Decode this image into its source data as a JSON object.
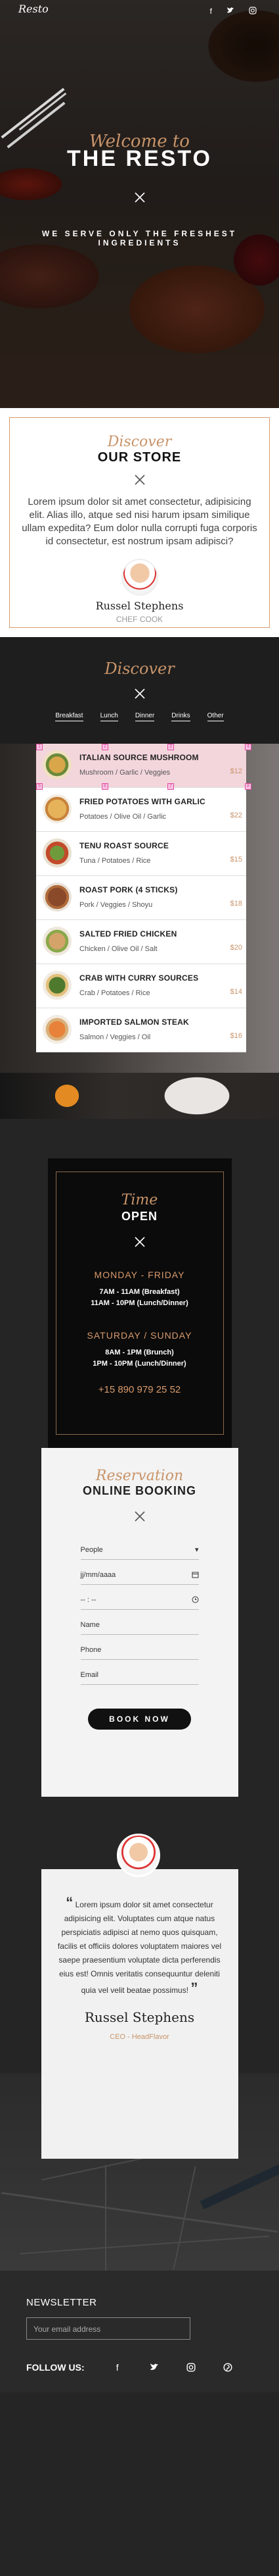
{
  "header": {
    "brand": "Resto",
    "social": [
      "f",
      "t",
      "i"
    ]
  },
  "hero": {
    "welcome": "Welcome to",
    "title": "THE RESTO",
    "subtitle": "WE SERVE ONLY THE FRESHEST INGREDIENTS"
  },
  "store": {
    "script_title": "Discover",
    "title": "OUR STORE",
    "text": "Lorem ipsum dolor sit amet consectetur, adipisicing elit. Alias illo, atque sed nisi harum ipsam similique ullam expedita? Eum dolor nulla corrupti fuga corporis id consectetur, est nostrum ipsam adipisci?",
    "chef_name": "Russel Stephens",
    "chef_role": "CHEF COOK"
  },
  "menu": {
    "script_title": "Discover",
    "tabs": [
      "Breakfast",
      "Lunch",
      "Dinner",
      "Drinks",
      "Other"
    ],
    "items": [
      {
        "name": "ITALIAN SOURCE MUSHROOM",
        "ingredients": "Mushroom / Garlic / Veggies",
        "price": "$12"
      },
      {
        "name": "FRIED POTATOES WITH GARLIC",
        "ingredients": "Potatoes / Olive Oil / Garlic",
        "price": "$22"
      },
      {
        "name": "TENU ROAST SOURCE",
        "ingredients": "Tuna / Potatoes / Rice",
        "price": "$15"
      },
      {
        "name": "ROAST PORK (4 STICKS)",
        "ingredients": "Pork / Veggies / Shoyu",
        "price": "$18"
      },
      {
        "name": "SALTED FRIED CHICKEN",
        "ingredients": "Chicken / Olive Oil / Salt",
        "price": "$20"
      },
      {
        "name": "CRAB WITH CURRY SOURCES",
        "ingredients": "Crab / Potatoes / Rice",
        "price": "$14"
      },
      {
        "name": "IMPORTED SALMON STEAK",
        "ingredients": "Salmon / Veggies / Oil",
        "price": "$16"
      }
    ]
  },
  "time": {
    "script_title": "Time",
    "title": "OPEN",
    "weekday_label": "MONDAY - FRIDAY",
    "weekday_hours_1": "7AM - 11AM (Breakfast)",
    "weekday_hours_2": "11AM - 10PM (Lunch/Dinner)",
    "weekend_label": "SATURDAY / SUNDAY",
    "weekend_hours_1": "8AM - 1PM (Brunch)",
    "weekend_hours_2": "1PM - 10PM (Lunch/Dinner)",
    "phone": "+15 890 979 25 52"
  },
  "reservation": {
    "script_title": "Reservation",
    "title": "ONLINE BOOKING",
    "people_value": "People",
    "date_placeholder": "jj/mm/aaaa",
    "time_placeholder": "-- : --",
    "name_placeholder": "Name",
    "phone_placeholder": "Phone",
    "email_placeholder": "Email",
    "button": "BOOK NOW"
  },
  "testimonial": {
    "open_quote": "“",
    "close_quote": "”",
    "text": "Lorem ipsum dolor sit amet consectetur adipisicing elit. Voluptates cum atque natus perspiciatis adipisci at nemo quos quisquam, facilis et officiis dolores voluptatem maiores vel saepe praesentium voluptate dicta perferendis eius est! Omnis veritatis consequuntur deleniti quia vel velit beatae possimus!",
    "name": "Russel Stephens",
    "role": "CEO - HeadFlavor"
  },
  "newsletter": {
    "title": "NEWSLETTER",
    "placeholder": "Your email address",
    "follow_label": "FOLLOW US:",
    "social": [
      "f",
      "t",
      "i",
      "p"
    ]
  },
  "colors": {
    "accent": "#c8946a",
    "dark": "#252525",
    "selected_row": "#f3d6dc"
  }
}
